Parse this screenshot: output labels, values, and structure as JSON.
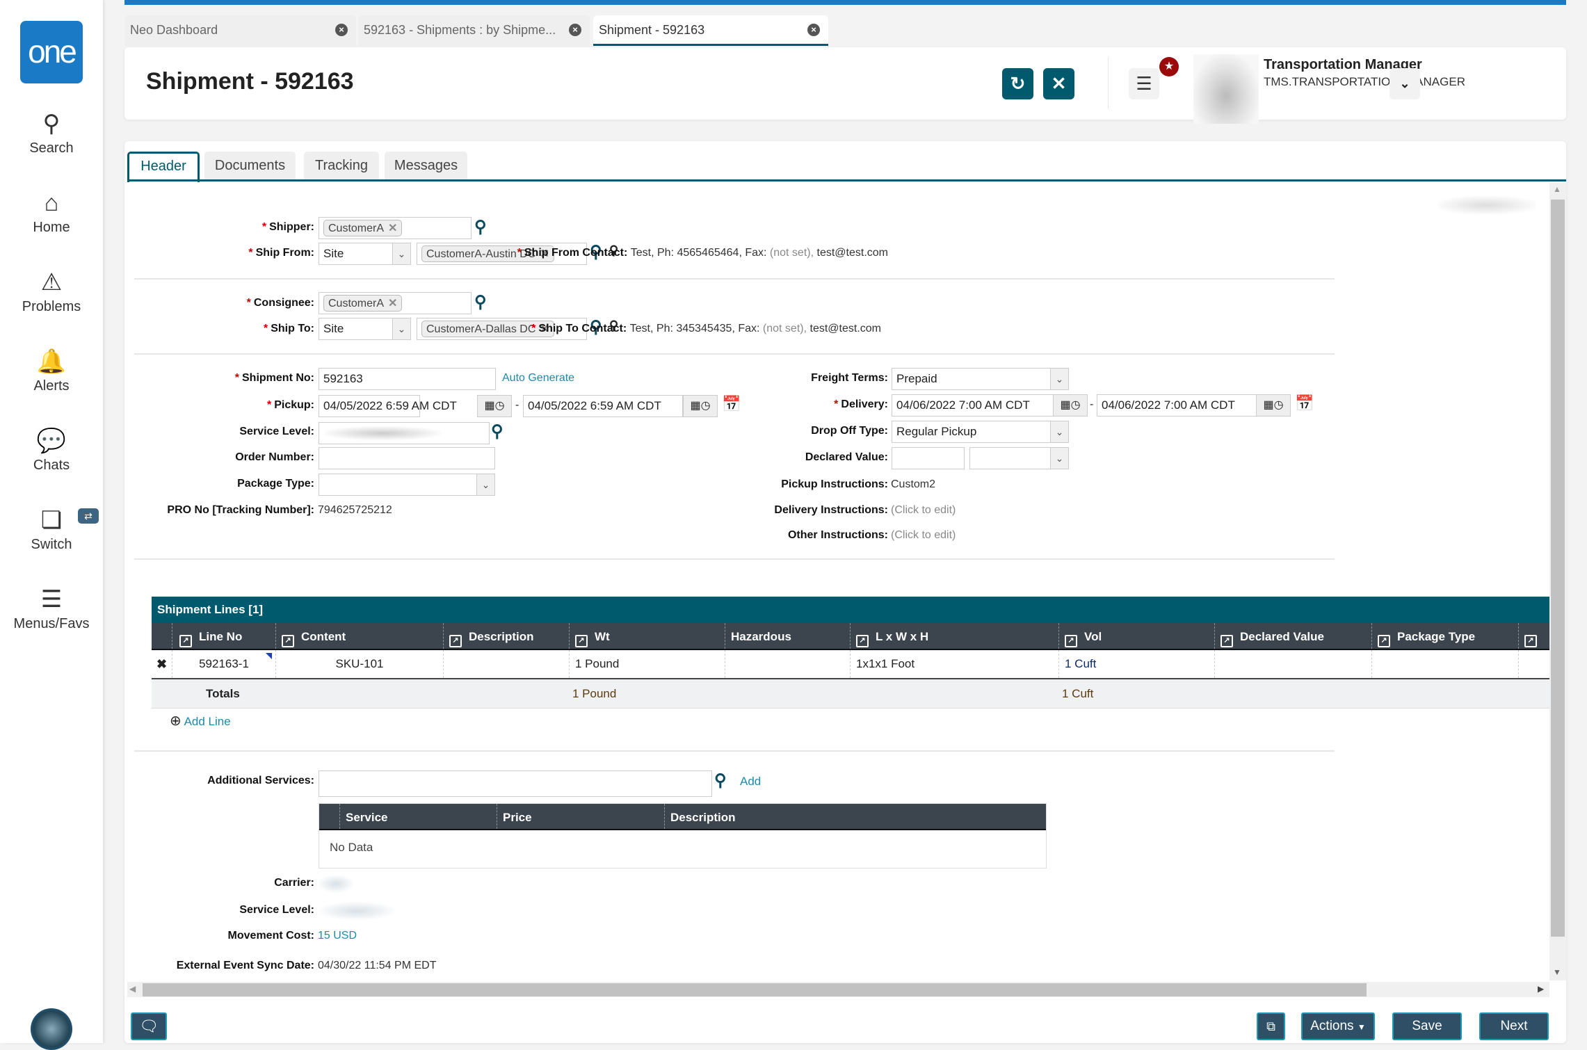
{
  "sidebar": {
    "logo": "one",
    "items": [
      {
        "label": "Search",
        "icon": "search-icon"
      },
      {
        "label": "Home",
        "icon": "home-icon"
      },
      {
        "label": "Problems",
        "icon": "warning-icon"
      },
      {
        "label": "Alerts",
        "icon": "bell-icon"
      },
      {
        "label": "Chats",
        "icon": "chat-icon"
      },
      {
        "label": "Switch",
        "icon": "switch-icon"
      },
      {
        "label": "Menus/Favs",
        "icon": "menu-icon"
      }
    ]
  },
  "browser_tabs": [
    {
      "label": "Neo Dashboard",
      "active": false
    },
    {
      "label": "592163 - Shipments : by Shipme...",
      "active": false
    },
    {
      "label": "Shipment - 592163",
      "active": true
    }
  ],
  "header": {
    "title": "Shipment - 592163",
    "user_name": "Transportation Manager",
    "user_role": "TMS.TRANSPORTATION_MANAGER"
  },
  "form_tabs": [
    "Header",
    "Documents",
    "Tracking",
    "Messages"
  ],
  "form": {
    "shipper": {
      "label": "Shipper:",
      "value": "CustomerA"
    },
    "ship_from": {
      "label": "Ship From:",
      "type": "Site",
      "value": "CustomerA-Austin DC"
    },
    "ship_from_contact": {
      "label": "Ship From Contact:",
      "pre": "Test, Ph: 4565465464, Fax:",
      "fax": "(not set),",
      "email": "test@test.com"
    },
    "consignee": {
      "label": "Consignee:",
      "value": "CustomerA"
    },
    "ship_to": {
      "label": "Ship To:",
      "type": "Site",
      "value": "CustomerA-Dallas DC"
    },
    "ship_to_contact": {
      "label": "Ship To Contact:",
      "pre": "Test, Ph: 345345435, Fax:",
      "fax": "(not set),",
      "email": "test@test.com"
    },
    "shipment_no": {
      "label": "Shipment No:",
      "value": "592163",
      "link": "Auto Generate"
    },
    "pickup": {
      "label": "Pickup:",
      "from": "04/05/2022 6:59 AM CDT",
      "to": "04/05/2022 6:59 AM CDT"
    },
    "service_level": {
      "label": "Service Level:"
    },
    "order_number": {
      "label": "Order Number:",
      "value": ""
    },
    "package_type": {
      "label": "Package Type:",
      "value": ""
    },
    "pro_no": {
      "label": "PRO No [Tracking Number]:",
      "value": "794625725212"
    },
    "freight_terms": {
      "label": "Freight Terms:",
      "value": "Prepaid"
    },
    "delivery": {
      "label": "Delivery:",
      "from": "04/06/2022 7:00 AM CDT",
      "to": "04/06/2022 7:00 AM CDT"
    },
    "drop_off_type": {
      "label": "Drop Off Type:",
      "value": "Regular Pickup"
    },
    "declared_value": {
      "label": "Declared Value:",
      "value": "",
      "currency": ""
    },
    "pickup_instructions": {
      "label": "Pickup Instructions:",
      "value": "Custom2"
    },
    "delivery_instructions": {
      "label": "Delivery Instructions:",
      "value": "(Click to edit)"
    },
    "other_instructions": {
      "label": "Other Instructions:",
      "value": "(Click to edit)"
    }
  },
  "shipment_lines": {
    "title": "Shipment Lines [1]",
    "columns": [
      "Line No",
      "Content",
      "Description",
      "Wt",
      "Hazardous",
      "L x W x H",
      "Vol",
      "Declared Value",
      "Package Type"
    ],
    "rows": [
      {
        "line_no": "592163-1",
        "content": "SKU-101",
        "description": "",
        "wt": "1 Pound",
        "hazardous": "",
        "lwh": "1x1x1 Foot",
        "vol": "1 Cuft",
        "declared_value": "",
        "package_type": ""
      }
    ],
    "totals": {
      "label": "Totals",
      "wt": "1 Pound",
      "vol": "1 Cuft"
    },
    "add_line": "Add Line"
  },
  "additional_services": {
    "label": "Additional Services:",
    "value": "",
    "add": "Add",
    "columns": [
      "Service",
      "Price",
      "Description"
    ],
    "empty": "No Data"
  },
  "carrier": {
    "label": "Carrier:"
  },
  "service_level2": {
    "label": "Service Level:"
  },
  "movement_cost": {
    "label": "Movement Cost:",
    "value": "15 USD"
  },
  "external_sync": {
    "label": "External Event Sync Date:",
    "value": "04/30/22 11:54 PM EDT"
  },
  "footer": {
    "actions": "Actions",
    "save": "Save",
    "next": "Next"
  },
  "colors": {
    "brand": "#1b7ac6",
    "teal": "#005a6e",
    "button": "#2e4f66",
    "grid_header": "#3c444d"
  }
}
